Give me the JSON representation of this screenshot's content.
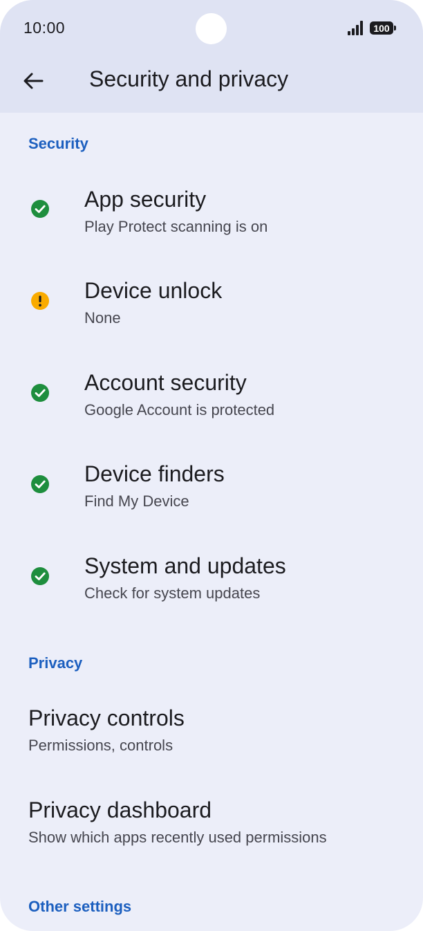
{
  "status_bar": {
    "time": "10:00",
    "battery": "100"
  },
  "header": {
    "title": "Security and privacy"
  },
  "sections": {
    "security": "Security",
    "privacy": "Privacy",
    "other": "Other settings"
  },
  "security_items": [
    {
      "title": "App security",
      "subtitle": "Play Protect scanning is on",
      "status": "ok"
    },
    {
      "title": "Device unlock",
      "subtitle": "None",
      "status": "warning"
    },
    {
      "title": "Account security",
      "subtitle": "Google Account is protected",
      "status": "ok"
    },
    {
      "title": "Device finders",
      "subtitle": "Find My Device",
      "status": "ok"
    },
    {
      "title": "System and updates",
      "subtitle": "Check for system updates",
      "status": "ok"
    }
  ],
  "privacy_items": [
    {
      "title": "Privacy controls",
      "subtitle": "Permissions, controls"
    },
    {
      "title": "Privacy dashboard",
      "subtitle": "Show which apps recently used permissions"
    }
  ],
  "colors": {
    "accent": "#1c5fbf",
    "ok": "#1e8e3e",
    "warning": "#f9ab00",
    "background": "#eceef9",
    "header_background": "#dfe3f3"
  }
}
